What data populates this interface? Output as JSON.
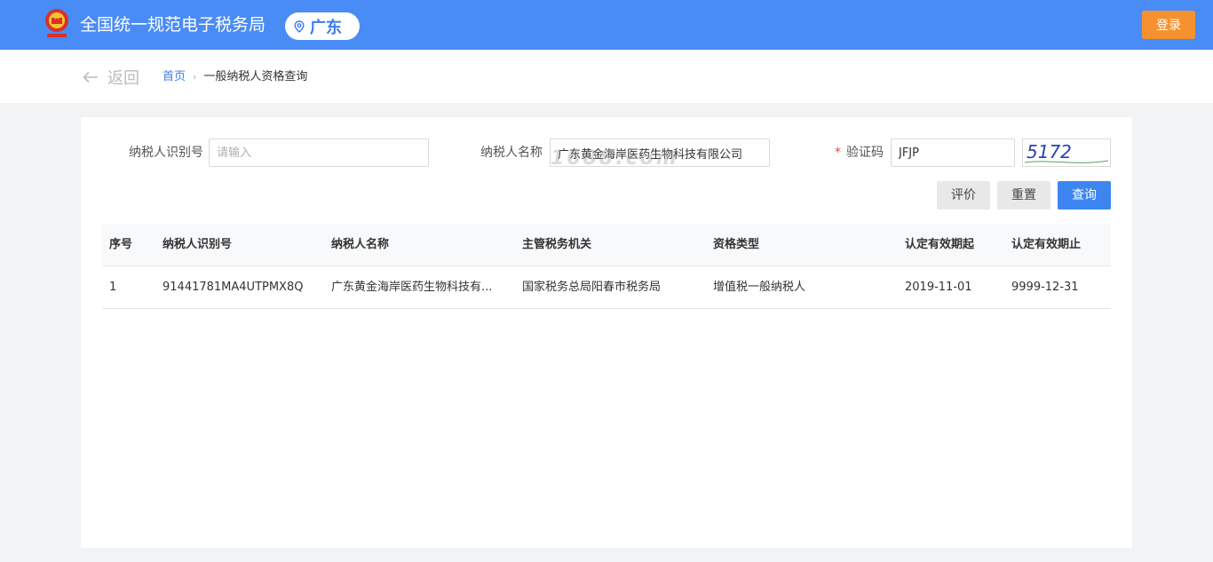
{
  "header": {
    "title": "全国统一规范电子税务局",
    "region": "广东",
    "login_label": "登录",
    "brand_color": "#4a8cf5"
  },
  "breadcrumb": {
    "back_label": "返回",
    "home": "首页",
    "current": "一般纳税人资格查询"
  },
  "form": {
    "taxpayer_id_label": "纳税人识别号",
    "taxpayer_id_placeholder": "请输入",
    "taxpayer_id_value": "",
    "taxpayer_name_label": "纳税人名称",
    "taxpayer_name_value": "广东黄金海岸医药生物科技有限公司",
    "captcha_label": "验证码",
    "captcha_required_mark": "*",
    "captcha_value": "JFJP",
    "captcha_image_text": "5172"
  },
  "buttons": {
    "evaluate": "评价",
    "reset": "重置",
    "query": "查询"
  },
  "table": {
    "columns": [
      "序号",
      "纳税人识别号",
      "纳税人名称",
      "主管税务机关",
      "资格类型",
      "认定有效期起",
      "认定有效期止"
    ],
    "rows": [
      [
        "1",
        "91441781MA4UTPMX8Q",
        "广东黄金海岸医药生物科技有...",
        "国家税务总局阳春市税务局",
        "增值税一般纳税人",
        "2019-11-01",
        "9999-12-31"
      ]
    ]
  },
  "watermark": "1688.com"
}
